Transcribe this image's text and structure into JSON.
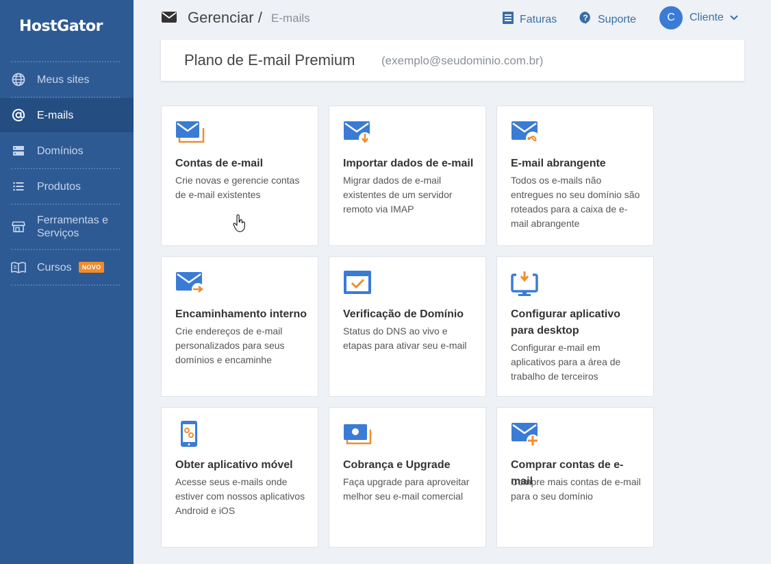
{
  "brand": {
    "logo": "HostGator"
  },
  "sidebar": {
    "items": [
      {
        "label": "Meus sites",
        "icon": "globe-icon",
        "active": false
      },
      {
        "label": "E-mails",
        "icon": "at-icon",
        "active": true
      },
      {
        "label": "Domínios",
        "icon": "server-icon",
        "active": false
      },
      {
        "label": "Produtos",
        "icon": "list-icon",
        "active": false
      },
      {
        "label": "Ferramentas e Serviços",
        "icon": "store-icon",
        "active": false
      },
      {
        "label": "Cursos",
        "icon": "book-icon",
        "active": false,
        "badge": "NOVO"
      }
    ]
  },
  "header": {
    "breadcrumb_main": "Gerenciar /",
    "breadcrumb_sub": "E-mails",
    "faturas": "Faturas",
    "suporte": "Suporte",
    "avatar_initial": "C",
    "user": "Cliente"
  },
  "plan": {
    "title": "Plano de E-mail Premium",
    "email": "(exemplo@seudominio.com.br)"
  },
  "cards": [
    {
      "title": "Contas de e-mail",
      "desc": "Crie novas e gerencie contas de e-mail existentes",
      "icon": "mail-accounts-icon"
    },
    {
      "title": "Importar dados de e-mail",
      "desc": "Migrar dados de e-mail existentes de um servidor remoto via IMAP",
      "icon": "mail-import-icon"
    },
    {
      "title": "E-mail abrangente",
      "desc": "Todos os e-mails não entregues no seu domínio são roteados para a caixa de e-mail abrangente",
      "icon": "mail-catchall-icon"
    },
    {
      "title": "Encaminhamento interno",
      "desc": "Crie endereços de e-mail personalizados para seus domínios e encaminhe",
      "icon": "mail-forward-icon"
    },
    {
      "title": "Verificação de Domínio",
      "desc": "Status do DNS ao vivo e etapas para ativar seu e-mail",
      "icon": "domain-check-icon"
    },
    {
      "title": "Configurar aplicativo para desktop",
      "desc": "Configurar e-mail em aplicativos para a área de trabalho de terceiros",
      "icon": "desktop-config-icon"
    },
    {
      "title": "Obter aplicativo móvel",
      "desc": "Acesse seus e-mails onde estiver com nossos aplicativos Android e iOS",
      "icon": "mobile-app-icon"
    },
    {
      "title": "Cobrança e Upgrade",
      "desc": "Faça upgrade para aproveitar melhor seu e-mail comercial",
      "icon": "billing-icon"
    },
    {
      "title": "Comprar contas de e-mail",
      "desc": "Compre mais contas de e-mail para o seu domínio",
      "icon": "mail-add-icon"
    }
  ],
  "colors": {
    "sidebar": "#2e5a94",
    "sidebar_active": "#244d82",
    "accent_blue": "#3a7bd5",
    "accent_orange": "#f28b2c",
    "background": "#eef1f6"
  }
}
